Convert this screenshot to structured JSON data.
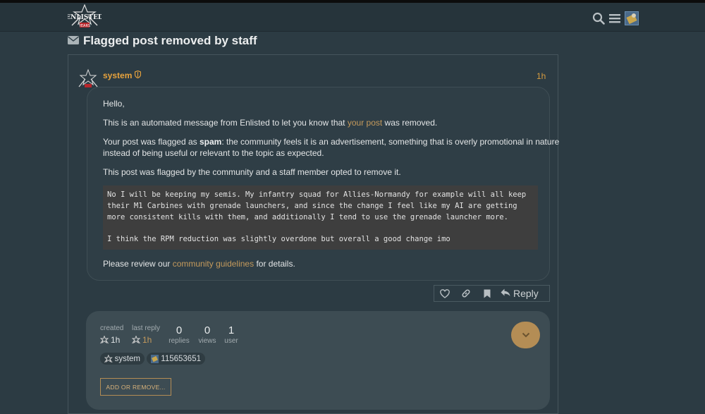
{
  "header": {
    "logo_text": "ENLISTED",
    "logo_sub": "YEARS"
  },
  "topic": {
    "title": "Flagged post removed by staff"
  },
  "post": {
    "author": "system",
    "time": "1h",
    "greeting": "Hello,",
    "p1_pre": "This is an automated message from Enlisted to let you know that ",
    "p1_link": "your post",
    "p1_post": " was removed.",
    "p2_line1_pre": "Your post was flagged as ",
    "p2_bold": "spam",
    "p2_line1_post": ": the community feels it is an advertisement, something that is overly promotional in nature",
    "p2_line2": "instead of being useful or relevant to the topic as expected.",
    "p3": "This post was flagged by the community and a staff member opted to remove it.",
    "quote": [
      "No I will be keeping my semis. My infantry squad for Allies-Normandy for example will all keep",
      "their M1 Carbines with grenade launchers, and since the change I feel like my AI are getting",
      "more consistent kills with them, and additionally I tend to use the grenade launcher more.",
      "",
      "I think the RPM reduction was slightly overdone but overall a good change imo"
    ],
    "p4_pre": "Please review our ",
    "p4_link": "community guidelines",
    "p4_post": " for details."
  },
  "actions": {
    "reply_label": "Reply"
  },
  "topic_map": {
    "created_label": "created",
    "created_value": "1h",
    "last_reply_label": "last reply",
    "last_reply_value": "1h",
    "replies_count": "0",
    "replies_label": "replies",
    "views_count": "0",
    "views_label": "views",
    "users_count": "1",
    "users_label": "user",
    "participants": [
      "system",
      "115653651"
    ],
    "add_button": "ADD OR REMOVE..."
  },
  "colors": {
    "accent": "#e8a33d",
    "link": "#c49a5c",
    "background": "#2c3b43"
  }
}
